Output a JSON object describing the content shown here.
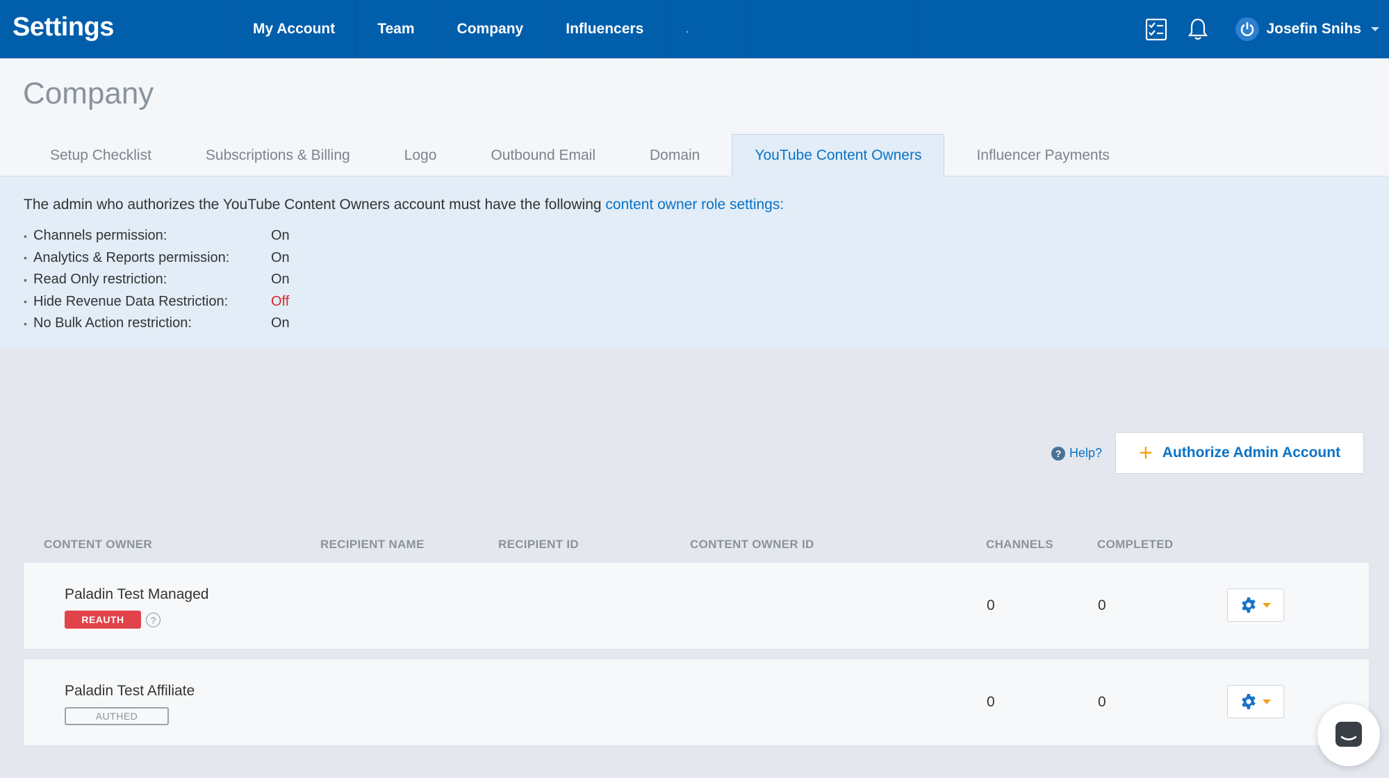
{
  "app": {
    "title": "Settings"
  },
  "nav": {
    "items": [
      {
        "label": "My Account"
      },
      {
        "label": "Team"
      },
      {
        "label": "Company"
      },
      {
        "label": "Influencers"
      }
    ],
    "dot": "."
  },
  "user": {
    "name": "Josefin Snihs"
  },
  "page": {
    "title": "Company"
  },
  "tabs": [
    {
      "label": "Setup Checklist"
    },
    {
      "label": "Subscriptions & Billing"
    },
    {
      "label": "Logo"
    },
    {
      "label": "Outbound Email"
    },
    {
      "label": "Domain"
    },
    {
      "label": "YouTube Content Owners",
      "active": true
    },
    {
      "label": "Influencer Payments"
    }
  ],
  "info": {
    "lead": "The admin who authorizes the YouTube Content Owners account must have the following ",
    "link": "content owner role settings:",
    "permissions": [
      {
        "label": "Channels permission:",
        "value": "On"
      },
      {
        "label": "Analytics & Reports permission:",
        "value": "On"
      },
      {
        "label": "Read Only restriction:",
        "value": "On"
      },
      {
        "label": "Hide Revenue Data Restriction:",
        "value": "Off"
      },
      {
        "label": "No Bulk Action restriction:",
        "value": "On"
      }
    ]
  },
  "actions": {
    "help": "Help?",
    "authorize": "Authorize Admin Account"
  },
  "table": {
    "headers": {
      "content_owner": "CONTENT OWNER",
      "recipient_name": "RECIPIENT NAME",
      "recipient_id": "RECIPIENT ID",
      "content_owner_id": "CONTENT OWNER ID",
      "channels": "CHANNELS",
      "completed": "COMPLETED"
    },
    "rows": [
      {
        "name": "Paladin Test Managed",
        "status": "REAUTH",
        "channels": "0",
        "completed": "0"
      },
      {
        "name": "Paladin Test Affiliate",
        "status": "AUTHED",
        "channels": "0",
        "completed": "0"
      }
    ]
  },
  "colors": {
    "brand": "#005eab",
    "link": "#0a72c6",
    "off": "#d72a2a",
    "reauth": "#e2424a",
    "accent": "#f0a31b"
  },
  "icons": [
    "checklist-icon",
    "bell-icon",
    "power-icon",
    "gear-icon",
    "question-icon",
    "plus-icon",
    "chat-icon"
  ]
}
